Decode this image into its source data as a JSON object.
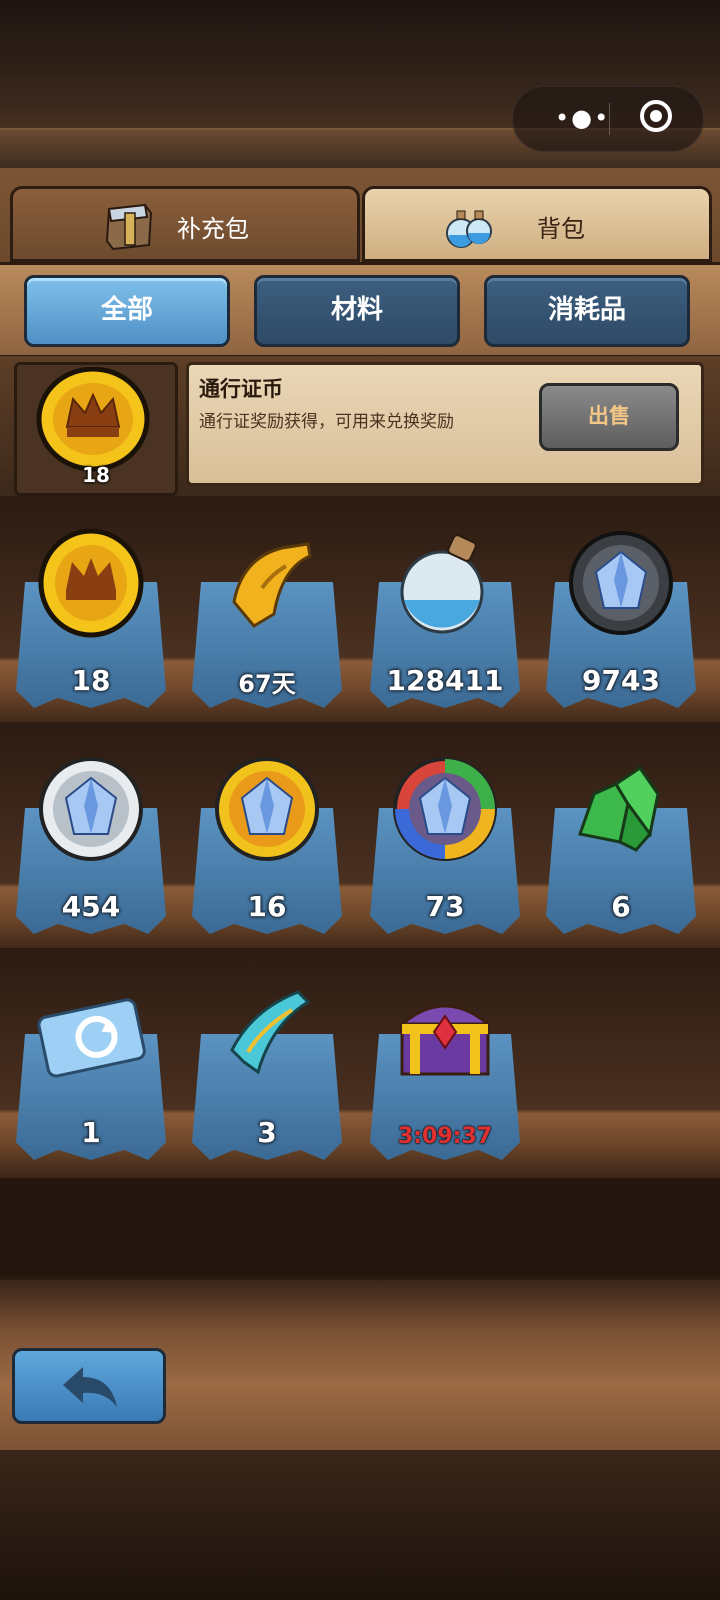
{
  "tabs": [
    {
      "label": "补充包",
      "icon": "box-icon"
    },
    {
      "label": "背包",
      "icon": "potion-icon"
    }
  ],
  "filters": [
    {
      "label": "全部",
      "active": true
    },
    {
      "label": "材料",
      "active": false
    },
    {
      "label": "消耗品",
      "active": false
    }
  ],
  "detail": {
    "name": "通行证币",
    "description": "通行证奖励获得，可用来兑换奖励",
    "count": "18",
    "sell_label": "出售",
    "icon": "crown-coin-icon"
  },
  "items": [
    {
      "icon": "crown-coin-icon",
      "count": "18"
    },
    {
      "icon": "golden-scroll-icon",
      "count": "67天"
    },
    {
      "icon": "water-flask-icon",
      "count": "128411"
    },
    {
      "icon": "dark-crystal-orb-icon",
      "count": "9743"
    },
    {
      "icon": "silver-crystal-orb-icon",
      "count": "454"
    },
    {
      "icon": "gold-crystal-orb-icon",
      "count": "16"
    },
    {
      "icon": "rainbow-crystal-orb-icon",
      "count": "73"
    },
    {
      "icon": "green-ore-icon",
      "count": "6"
    },
    {
      "icon": "refresh-ticket-icon",
      "count": "1"
    },
    {
      "icon": "teal-banner-icon",
      "count": "3"
    },
    {
      "icon": "treasure-chest-icon",
      "count": "3:09:37",
      "timer": true
    }
  ],
  "colors": {
    "active_filter": "#5fa8dc",
    "inactive_filter": "#2e4a66",
    "timer_red": "#e03030",
    "wood": "#7b5535"
  }
}
